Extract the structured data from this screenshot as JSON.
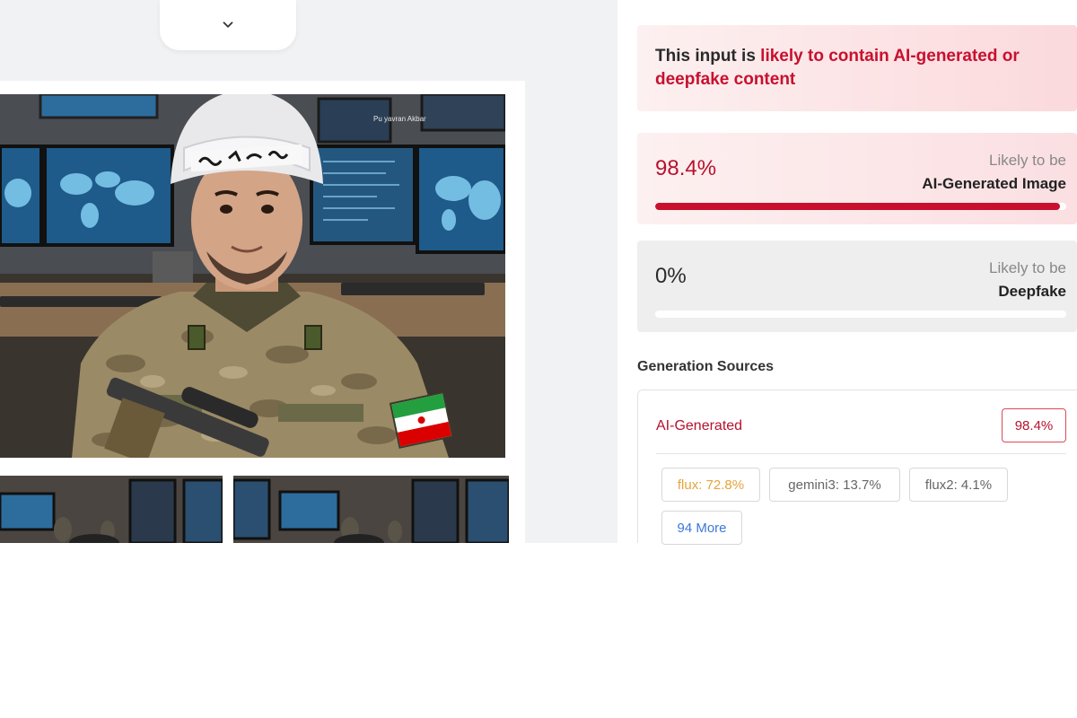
{
  "image": {
    "overlay_text": "Pu yavran Akbar"
  },
  "verdict": {
    "prefix": "This input is ",
    "highlight": "likely to contain AI-generated or deepfake content"
  },
  "scores": [
    {
      "value": "98.4%",
      "fraction": 0.984,
      "sub_label": "Likely to be",
      "label": "AI-Generated Image",
      "color": "#c8102e"
    },
    {
      "value": "0%",
      "fraction": 0.0,
      "sub_label": "Likely to be",
      "label": "Deepfake",
      "color": "#b9b9bb"
    }
  ],
  "generation_sources": {
    "title": "Generation Sources",
    "category": "AI-Generated",
    "category_value": "98.4%",
    "chips": [
      {
        "label": "flux: 72.8%"
      },
      {
        "label": "gemini3: 13.7%"
      },
      {
        "label": "flux2: 4.1%"
      }
    ],
    "more_label": "94 More"
  },
  "icons": {
    "collapse": "chevron-down-icon",
    "flag": "iran-flag-icon"
  }
}
